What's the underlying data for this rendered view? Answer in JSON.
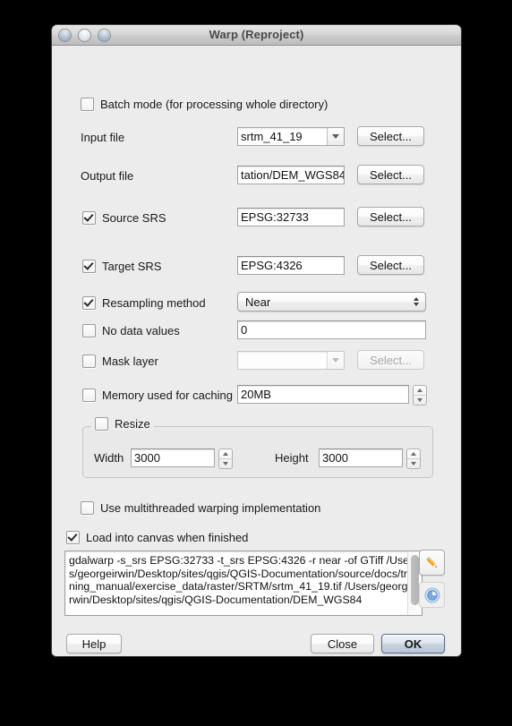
{
  "window": {
    "title": "Warp (Reproject)",
    "traffic_lights": [
      "close-light",
      "minimize-light",
      "zoom-light"
    ]
  },
  "form": {
    "batch_mode": {
      "label": "Batch mode (for processing whole directory)",
      "checked": false
    },
    "input_file": {
      "label": "Input file",
      "value": "srtm_41_19",
      "select_label": "Select..."
    },
    "output_file": {
      "label": "Output file",
      "value": "tation/DEM_WGS84",
      "select_label": "Select..."
    },
    "source_srs": {
      "label": "Source SRS",
      "checked": true,
      "value": "EPSG:32733",
      "select_label": "Select..."
    },
    "target_srs": {
      "label": "Target SRS",
      "checked": true,
      "value": "EPSG:4326",
      "select_label": "Select..."
    },
    "resampling": {
      "label": "Resampling method",
      "checked": true,
      "value": "Near"
    },
    "no_data": {
      "label": "No data values",
      "checked": false,
      "value": "0"
    },
    "mask_layer": {
      "label": "Mask layer",
      "checked": false,
      "value": "",
      "select_label": "Select...",
      "disabled": true
    },
    "memory": {
      "label": "Memory used for caching",
      "checked": false,
      "value": "20MB"
    },
    "resize": {
      "label": "Resize",
      "checked": false,
      "width_label": "Width",
      "width_value": "3000",
      "height_label": "Height",
      "height_value": "3000"
    },
    "multithreaded": {
      "label": "Use multithreaded warping implementation",
      "checked": false
    },
    "load_into_canvas": {
      "label": "Load into canvas when finished",
      "checked": true
    }
  },
  "command": {
    "text": "gdalwarp -s_srs EPSG:32733 -t_srs EPSG:4326 -r near -of GTiff /Users/georgeirwin/Desktop/sites/qgis/QGIS-Documentation/source/docs/training_manual/exercise_data/raster/SRTM/srtm_41_19.tif /Users/georgeirwin/Desktop/sites/qgis/QGIS-Documentation/DEM_WGS84"
  },
  "side_buttons": [
    {
      "name": "edit-pencil-icon",
      "title": "Edit"
    },
    {
      "name": "globe-icon",
      "title": "Help"
    }
  ],
  "footer": {
    "help_label": "Help",
    "close_label": "Close",
    "ok_label": "OK"
  },
  "colors": {
    "window_bg": "#ececec",
    "default_button_border": "#5b6f8c",
    "pencil_icon": "#f5a623",
    "globe_icon": "#5b92d6"
  }
}
